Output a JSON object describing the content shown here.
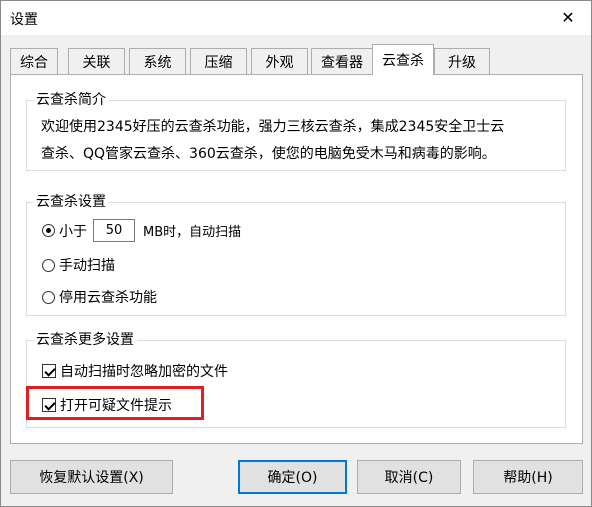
{
  "window": {
    "title": "设置",
    "close_glyph": "✕"
  },
  "tabs": [
    {
      "label": "综合"
    },
    {
      "label": "关联"
    },
    {
      "label": "系统"
    },
    {
      "label": "压缩"
    },
    {
      "label": "外观"
    },
    {
      "label": "查看器"
    },
    {
      "label": "云查杀",
      "active": true
    },
    {
      "label": "升级"
    }
  ],
  "intro": {
    "legend": "云查杀简介",
    "line1": "欢迎使用2345好压的云查杀功能，强力三核云查杀，集成2345安全卫士云",
    "line2": "查杀、QQ管家云查杀、360云查杀，使您的电脑免受木马和病毒的影响。"
  },
  "scan_settings": {
    "legend": "云查杀设置",
    "option_size_label": "小于",
    "size_value": "50",
    "size_unit": "MB时，自动扫描",
    "option_manual": "手动扫描",
    "option_disable": "停用云查杀功能",
    "selected": "size"
  },
  "more_settings": {
    "legend": "云查杀更多设置",
    "ignore_encrypted": "自动扫描时忽略加密的文件",
    "suspicious_prompt": "打开可疑文件提示",
    "ignore_encrypted_checked": true,
    "suspicious_prompt_checked": true
  },
  "buttons": {
    "restore": "恢复默认设置(X)",
    "ok": "确定(O)",
    "cancel": "取消(C)",
    "help": "帮助(H)"
  },
  "colors": {
    "highlight": "#e02020",
    "default_button_border": "#0078d7"
  }
}
